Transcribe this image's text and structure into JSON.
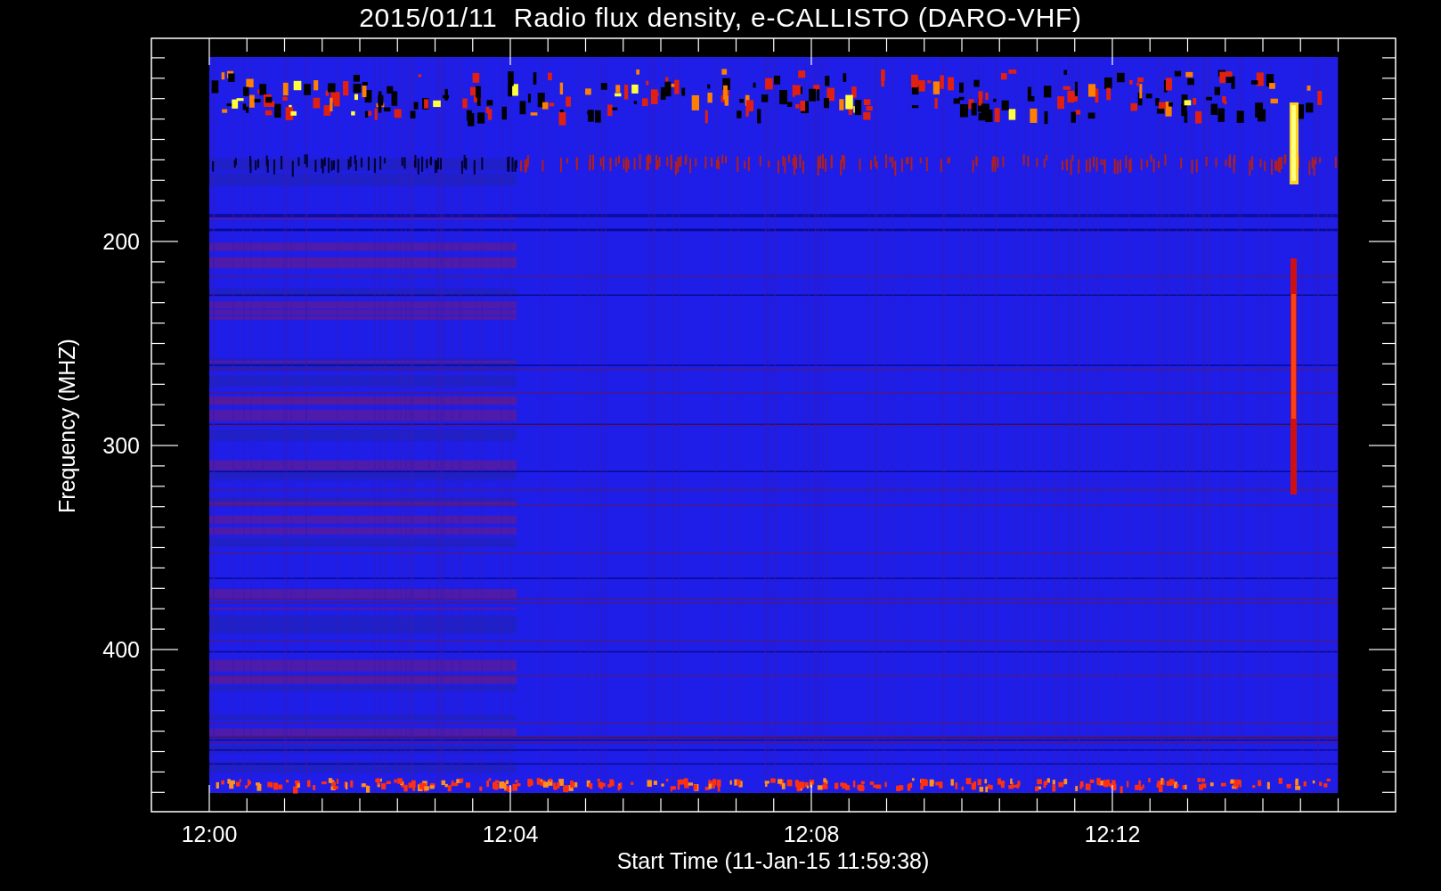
{
  "title": "2015/01/11  Radio flux density, e-CALLISTO (DARO-VHF)",
  "y_axis": {
    "label": "Frequency (MHZ)",
    "ticks": [
      "200",
      "300",
      "400"
    ]
  },
  "x_axis": {
    "label": "Start Time (11-Jan-15 11:59:38)",
    "ticks": [
      "12:00",
      "12:04",
      "12:08",
      "12:12"
    ]
  }
}
